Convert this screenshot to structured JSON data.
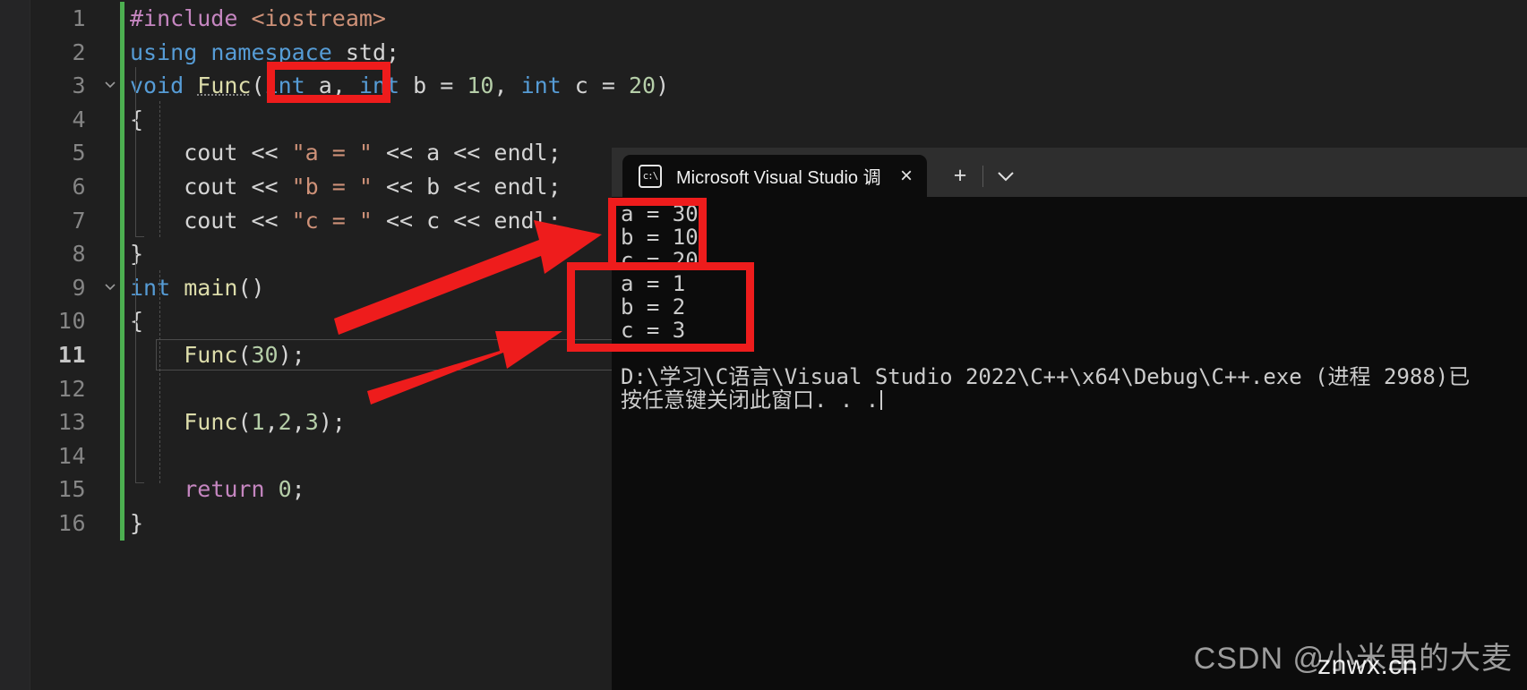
{
  "editor": {
    "language": "cpp",
    "lines": [
      {
        "num": "1",
        "fold": "",
        "changed": true,
        "active": false,
        "tokens": [
          {
            "t": "#include ",
            "c": "pre"
          },
          {
            "t": "<iostream>",
            "c": "hdr"
          }
        ]
      },
      {
        "num": "2",
        "fold": "",
        "changed": true,
        "active": false,
        "tokens": [
          {
            "t": "using",
            "c": "kw"
          },
          {
            "t": " ",
            "c": "plain"
          },
          {
            "t": "namespace",
            "c": "kw"
          },
          {
            "t": " std;",
            "c": "plain"
          }
        ]
      },
      {
        "num": "3",
        "fold": "v",
        "changed": true,
        "active": false,
        "tokens": [
          {
            "t": "void",
            "c": "kw"
          },
          {
            "t": " ",
            "c": "plain"
          },
          {
            "t": "Func",
            "c": "fn wavy"
          },
          {
            "t": "(",
            "c": "plain"
          },
          {
            "t": "int",
            "c": "kw"
          },
          {
            "t": " a, ",
            "c": "plain"
          },
          {
            "t": "int",
            "c": "kw"
          },
          {
            "t": " b = ",
            "c": "plain"
          },
          {
            "t": "10",
            "c": "num"
          },
          {
            "t": ", ",
            "c": "plain"
          },
          {
            "t": "int",
            "c": "kw"
          },
          {
            "t": " c = ",
            "c": "plain"
          },
          {
            "t": "20",
            "c": "num"
          },
          {
            "t": ")",
            "c": "plain"
          }
        ]
      },
      {
        "num": "4",
        "fold": "",
        "changed": true,
        "active": false,
        "tokens": [
          {
            "t": "{",
            "c": "plain"
          }
        ]
      },
      {
        "num": "5",
        "fold": "",
        "changed": true,
        "active": false,
        "tokens": [
          {
            "t": "    cout << ",
            "c": "plain"
          },
          {
            "t": "\"a = \"",
            "c": "str"
          },
          {
            "t": " << a << endl;",
            "c": "plain"
          }
        ]
      },
      {
        "num": "6",
        "fold": "",
        "changed": true,
        "active": false,
        "tokens": [
          {
            "t": "    cout << ",
            "c": "plain"
          },
          {
            "t": "\"b = \"",
            "c": "str"
          },
          {
            "t": " << b << endl;",
            "c": "plain"
          }
        ]
      },
      {
        "num": "7",
        "fold": "",
        "changed": true,
        "active": false,
        "tokens": [
          {
            "t": "    cout << ",
            "c": "plain"
          },
          {
            "t": "\"c = \"",
            "c": "str"
          },
          {
            "t": " << c << endl;",
            "c": "plain"
          }
        ]
      },
      {
        "num": "8",
        "fold": "",
        "changed": true,
        "active": false,
        "tokens": [
          {
            "t": "}",
            "c": "plain"
          }
        ]
      },
      {
        "num": "9",
        "fold": "v",
        "changed": true,
        "active": false,
        "tokens": [
          {
            "t": "int",
            "c": "kw"
          },
          {
            "t": " ",
            "c": "plain"
          },
          {
            "t": "main",
            "c": "fn"
          },
          {
            "t": "()",
            "c": "plain"
          }
        ]
      },
      {
        "num": "10",
        "fold": "",
        "changed": true,
        "active": false,
        "tokens": [
          {
            "t": "{",
            "c": "plain"
          }
        ]
      },
      {
        "num": "11",
        "fold": "",
        "changed": true,
        "active": true,
        "tokens": [
          {
            "t": "    ",
            "c": "plain"
          },
          {
            "t": "Func",
            "c": "fn"
          },
          {
            "t": "(",
            "c": "plain"
          },
          {
            "t": "30",
            "c": "num"
          },
          {
            "t": ");",
            "c": "plain"
          }
        ]
      },
      {
        "num": "12",
        "fold": "",
        "changed": true,
        "active": false,
        "tokens": [
          {
            "t": "",
            "c": "plain"
          }
        ]
      },
      {
        "num": "13",
        "fold": "",
        "changed": true,
        "active": false,
        "tokens": [
          {
            "t": "    ",
            "c": "plain"
          },
          {
            "t": "Func",
            "c": "fn"
          },
          {
            "t": "(",
            "c": "plain"
          },
          {
            "t": "1",
            "c": "num"
          },
          {
            "t": ",",
            "c": "plain"
          },
          {
            "t": "2",
            "c": "num"
          },
          {
            "t": ",",
            "c": "plain"
          },
          {
            "t": "3",
            "c": "num"
          },
          {
            "t": ");",
            "c": "plain"
          }
        ]
      },
      {
        "num": "14",
        "fold": "",
        "changed": true,
        "active": false,
        "tokens": [
          {
            "t": "",
            "c": "plain"
          }
        ]
      },
      {
        "num": "15",
        "fold": "",
        "changed": true,
        "active": false,
        "tokens": [
          {
            "t": "    ",
            "c": "plain"
          },
          {
            "t": "return",
            "c": "pre"
          },
          {
            "t": " ",
            "c": "plain"
          },
          {
            "t": "0",
            "c": "num"
          },
          {
            "t": ";",
            "c": "plain"
          }
        ]
      },
      {
        "num": "16",
        "fold": "",
        "changed": true,
        "active": false,
        "tokens": [
          {
            "t": "}",
            "c": "plain"
          }
        ]
      }
    ]
  },
  "terminal": {
    "tab": {
      "icon_label": "c:\\",
      "title": "Microsoft Visual Studio 调试控",
      "close_label": "×"
    },
    "actions": {
      "new_tab_label": "+",
      "dropdown_label": "⌄"
    },
    "output_lines": [
      "a = 30",
      "b = 10",
      "c = 20",
      "a = 1",
      "b = 2",
      "c = 3",
      "",
      "D:\\学习\\C语言\\Visual Studio 2022\\C++\\x64\\Debug\\C++.exe (进程 2988)已",
      "按任意键关闭此窗口. . ."
    ]
  },
  "annotations": {
    "box_color": "#ee1c1c",
    "boxes": [
      {
        "label": "param-int-a-highlight"
      },
      {
        "label": "output-first-call-highlight"
      },
      {
        "label": "output-second-call-highlight"
      }
    ],
    "arrows": [
      {
        "label": "arrow-func30-to-first-output"
      },
      {
        "label": "arrow-func123-to-second-output"
      }
    ]
  },
  "watermarks": {
    "csdn": "CSDN @小米里的大麦",
    "site": "znwx.cn"
  }
}
